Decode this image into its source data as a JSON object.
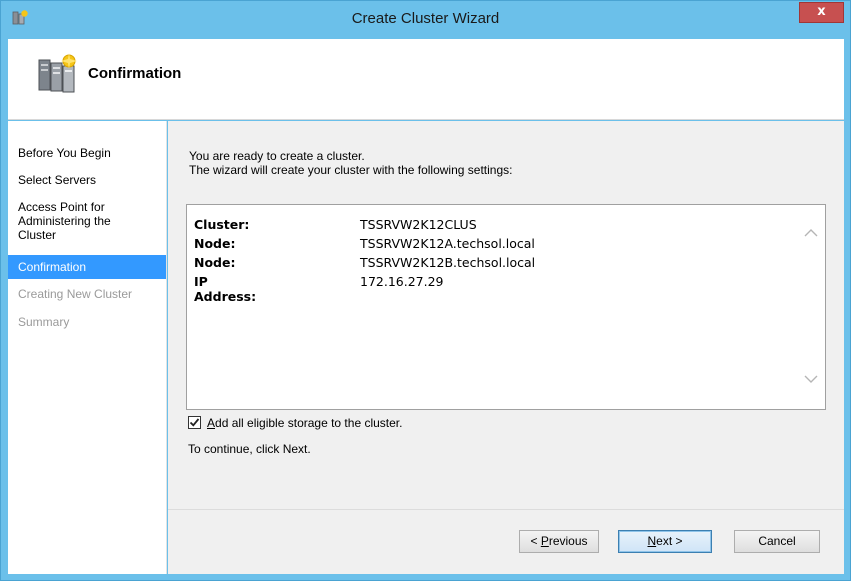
{
  "window": {
    "title": "Create Cluster Wizard",
    "close_glyph": "x"
  },
  "header": {
    "title": "Confirmation"
  },
  "sidebar": {
    "items": [
      {
        "label": "Before You Begin",
        "state": "normal"
      },
      {
        "label": "Select Servers",
        "state": "normal"
      },
      {
        "label": "Access Point for Administering the Cluster",
        "state": "normal"
      },
      {
        "label": "Confirmation",
        "state": "active"
      },
      {
        "label": "Creating New Cluster",
        "state": "disabled"
      },
      {
        "label": "Summary",
        "state": "disabled"
      }
    ],
    "access_point_lines": [
      "Access Point for",
      "Administering the",
      "Cluster"
    ]
  },
  "content": {
    "intro_line1": "You are ready to create a cluster.",
    "intro_line2": "The wizard will create your cluster with the following settings:",
    "settings": [
      {
        "key": "Cluster:",
        "value": "TSSRVW2K12CLUS"
      },
      {
        "key": "Node:",
        "value": "TSSRVW2K12A.techsol.local"
      },
      {
        "key": "Node:",
        "value": "TSSRVW2K12B.techsol.local"
      },
      {
        "key": "IP Address:",
        "value": "172.16.27.29"
      }
    ],
    "checkbox": {
      "label_accel": "A",
      "label_rest": "dd all eligible storage to the cluster.",
      "checked": true
    },
    "continue_text": "To continue, click Next."
  },
  "buttons": {
    "previous": {
      "prefix": "< ",
      "accel": "P",
      "rest": "revious"
    },
    "next": {
      "accel": "N",
      "rest": "ext >"
    },
    "cancel": {
      "label": "Cancel"
    }
  },
  "colors": {
    "titlebar": "#6bc0ea",
    "close": "#c75050",
    "active_nav": "#3399ff",
    "content_bg": "#f0f0f0"
  }
}
